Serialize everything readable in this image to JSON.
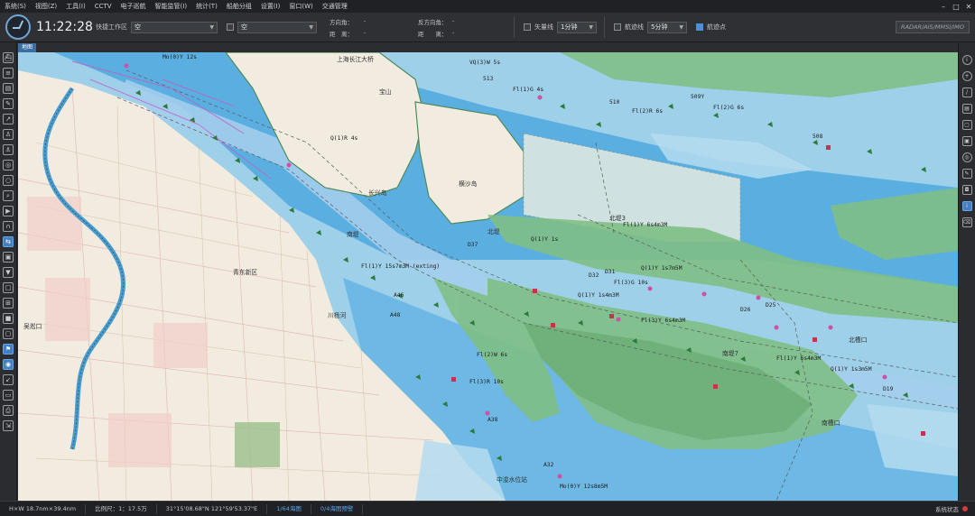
{
  "menu": {
    "items": [
      "系统(S)",
      "视图(Z)",
      "工具(I)",
      "CCTV",
      "电子巡航",
      "智能监管(I)",
      "统计(T)",
      "船舶分组",
      "设置(I)",
      "窗口(W)",
      "交通管理"
    ]
  },
  "toolbar": {
    "time": "11:22:28",
    "workspace_label": "快捷工作区",
    "workspace_value": "空",
    "second_value": "空",
    "bearing_label": "方向角：",
    "bearing_value": "-",
    "distance_label": "距　离：",
    "distance_value": "-",
    "reverse_bearing_label": "反方向角：",
    "reverse_bearing_value": "-",
    "reverse_distance_label": "距　　离：",
    "reverse_distance_value": "-",
    "vector_label": "矢量线",
    "vector_value": "1分钟",
    "track_label": "航迹线",
    "track_value": "5分钟",
    "trackpoint_label": "航迹点",
    "brand_text": "RADAR/AIS/MMSI/IMO"
  },
  "map": {
    "tab_label": "地图",
    "place_labels": [
      "青东新区",
      "川杨河",
      "长兴岛",
      "横沙岛",
      "北堤3",
      "南堤",
      "北堤",
      "南堤7",
      "北槽口",
      "南槽口",
      "上海长江大桥",
      "中浚水位站",
      "宝山",
      "吴淞口"
    ],
    "light_labels": [
      "Mo(0)Y 12s",
      "Q(1)R 4s",
      "Fl(1)G 4s",
      "Fl(2)R 6s",
      "Fl(2)G 6s",
      "Q(1)Y 1s",
      "Fl(1)Y 6s4m3M",
      "Q(1)Y 1s7m5M",
      "Fl(3)G 10s",
      "Fl(3)Y 6s4m3M",
      "VQ(3)W 5s",
      "Fl(3)R 10s",
      "Fl(1)Y 15s7m3M (exting)",
      "Mo(0)Y 12s8m5M",
      "Q(1)Y 1s4m3M",
      "Fl(2)W 6s",
      "Fl(1)Y 6s4m3M",
      "Q(1)Y 1s3m5M"
    ],
    "buoy_numbers": [
      "513",
      "510",
      "509Y",
      "508",
      "D37",
      "D32",
      "D31",
      "D26",
      "D25",
      "A46",
      "A48",
      "A38",
      "A32",
      "D19"
    ]
  },
  "status": {
    "scale_view": "H×W 18.7nm×39.4nm",
    "scale": "比例尺：1：17.5万",
    "coords": "31°15'08.68\"N  121°59'53.37\"E",
    "mode1": "1/64海图",
    "mode2": "0/4海图预警",
    "right_label": "系统状态"
  },
  "colors": {
    "deep_water": "#5aafe0",
    "shallow_water": "#9fd0ea",
    "land": "#f3eee3",
    "drying": "#7fbf86",
    "channel": "#3d8fd6"
  }
}
